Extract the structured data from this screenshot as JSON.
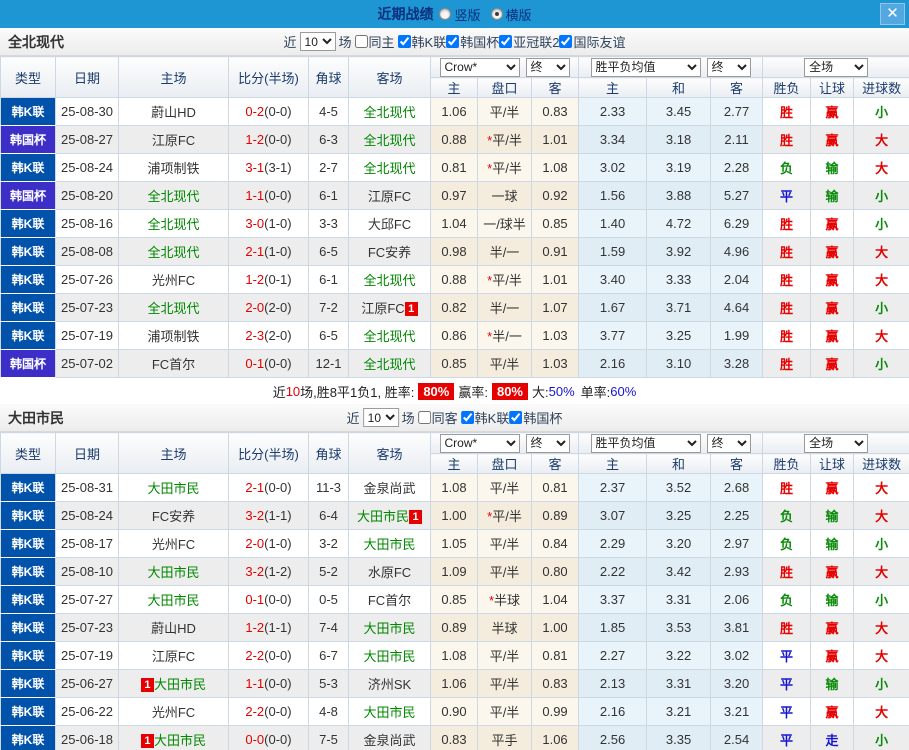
{
  "titlebar": {
    "title": "近期战绩",
    "radios": [
      {
        "label": "竖版",
        "checked": false
      },
      {
        "label": "横版",
        "checked": true
      }
    ],
    "close": "✕"
  },
  "table_header": {
    "cols": [
      "类型",
      "日期",
      "主场",
      "比分(半场)",
      "角球",
      "客场"
    ],
    "dd_odds": "Crow*",
    "dd_final": "终",
    "dd_mean": "胜平负均值",
    "dd_scope": "全场",
    "sub": [
      "主",
      "盘口",
      "客",
      "主",
      "和",
      "客",
      "胜负",
      "让球",
      "进球数"
    ]
  },
  "colors": {
    "titlebar_bg": "#1e96d4",
    "league_k": "#0052aa",
    "league_cup": "#3c2ec6",
    "team_highlight": "#008800",
    "result_red": "#e60000",
    "result_green": "#0a8a0a",
    "result_blue": "#1515d0"
  },
  "league_colors": {
    "韩K联": "k",
    "韩国杯": "cup"
  },
  "result_colors": {
    "胜": "red",
    "赢": "red",
    "大": "red",
    "平": "blue",
    "走": "blue",
    "负": "green",
    "输": "green",
    "小": "green"
  },
  "sections": [
    {
      "team": "全北现代",
      "filter": {
        "near": "近",
        "count": "10",
        "games": "场",
        "same": "同主",
        "same_checked": false,
        "leagues": [
          {
            "label": "韩K联",
            "checked": true
          },
          {
            "label": "韩国杯",
            "checked": true
          },
          {
            "label": "亚冠联2",
            "checked": true
          },
          {
            "label": "国际友谊",
            "checked": true
          }
        ]
      },
      "rows": [
        {
          "lg": "韩K联",
          "date": "25-08-30",
          "home": {
            "n": "蔚山HD",
            "g": false
          },
          "sc": "0-2",
          "hf": "(0-0)",
          "cr": "4-5",
          "away": {
            "n": "全北现代",
            "g": true
          },
          "o1": "1.06",
          "pan": "平/半",
          "o2": "0.83",
          "m": [
            "2.33",
            "3.45",
            "2.77"
          ],
          "r": [
            "胜",
            "赢",
            "小"
          ]
        },
        {
          "lg": "韩国杯",
          "date": "25-08-27",
          "home": {
            "n": "江原FC",
            "g": false
          },
          "sc": "1-2",
          "hf": "(0-0)",
          "cr": "6-3",
          "away": {
            "n": "全北现代",
            "g": true
          },
          "o1": "0.88",
          "pan": "*平/半",
          "o2": "1.01",
          "m": [
            "3.34",
            "3.18",
            "2.11"
          ],
          "r": [
            "胜",
            "赢",
            "大"
          ]
        },
        {
          "lg": "韩K联",
          "date": "25-08-24",
          "home": {
            "n": "浦项制铁",
            "g": false
          },
          "sc": "3-1",
          "hf": "(3-1)",
          "cr": "2-7",
          "away": {
            "n": "全北现代",
            "g": true
          },
          "o1": "0.81",
          "pan": "*平/半",
          "o2": "1.08",
          "m": [
            "3.02",
            "3.19",
            "2.28"
          ],
          "r": [
            "负",
            "输",
            "大"
          ]
        },
        {
          "lg": "韩国杯",
          "date": "25-08-20",
          "home": {
            "n": "全北现代",
            "g": true
          },
          "sc": "1-1",
          "hf": "(0-0)",
          "cr": "6-1",
          "away": {
            "n": "江原FC",
            "g": false
          },
          "o1": "0.97",
          "pan": "一球",
          "o2": "0.92",
          "m": [
            "1.56",
            "3.88",
            "5.27"
          ],
          "r": [
            "平",
            "输",
            "小"
          ]
        },
        {
          "lg": "韩K联",
          "date": "25-08-16",
          "home": {
            "n": "全北现代",
            "g": true
          },
          "sc": "3-0",
          "hf": "(1-0)",
          "cr": "3-3",
          "away": {
            "n": "大邱FC",
            "g": false
          },
          "o1": "1.04",
          "pan": "一/球半",
          "o2": "0.85",
          "m": [
            "1.40",
            "4.72",
            "6.29"
          ],
          "r": [
            "胜",
            "赢",
            "小"
          ]
        },
        {
          "lg": "韩K联",
          "date": "25-08-08",
          "home": {
            "n": "全北现代",
            "g": true
          },
          "sc": "2-1",
          "hf": "(1-0)",
          "cr": "6-5",
          "away": {
            "n": "FC安养",
            "g": false
          },
          "o1": "0.98",
          "pan": "半/一",
          "o2": "0.91",
          "m": [
            "1.59",
            "3.92",
            "4.96"
          ],
          "r": [
            "胜",
            "赢",
            "大"
          ]
        },
        {
          "lg": "韩K联",
          "date": "25-07-26",
          "home": {
            "n": "光州FC",
            "g": false
          },
          "sc": "1-2",
          "hf": "(0-1)",
          "cr": "6-1",
          "away": {
            "n": "全北现代",
            "g": true
          },
          "o1": "0.88",
          "pan": "*平/半",
          "o2": "1.01",
          "m": [
            "3.40",
            "3.33",
            "2.04"
          ],
          "r": [
            "胜",
            "赢",
            "大"
          ]
        },
        {
          "lg": "韩K联",
          "date": "25-07-23",
          "home": {
            "n": "全北现代",
            "g": true
          },
          "sc": "2-0",
          "hf": "(2-0)",
          "cr": "7-2",
          "away": {
            "n": "江原FC",
            "g": false,
            "b": "1",
            "bp": "after"
          },
          "o1": "0.82",
          "pan": "半/一",
          "o2": "1.07",
          "m": [
            "1.67",
            "3.71",
            "4.64"
          ],
          "r": [
            "胜",
            "赢",
            "小"
          ]
        },
        {
          "lg": "韩K联",
          "date": "25-07-19",
          "home": {
            "n": "浦项制铁",
            "g": false
          },
          "sc": "2-3",
          "hf": "(2-0)",
          "cr": "6-5",
          "away": {
            "n": "全北现代",
            "g": true
          },
          "o1": "0.86",
          "pan": "*半/一",
          "o2": "1.03",
          "m": [
            "3.77",
            "3.25",
            "1.99"
          ],
          "r": [
            "胜",
            "赢",
            "大"
          ]
        },
        {
          "lg": "韩国杯",
          "date": "25-07-02",
          "home": {
            "n": "FC首尔",
            "g": false
          },
          "sc": "0-1",
          "hf": "(0-0)",
          "cr": "12-1",
          "away": {
            "n": "全北现代",
            "g": true
          },
          "o1": "0.85",
          "pan": "平/半",
          "o2": "1.03",
          "m": [
            "2.16",
            "3.10",
            "3.28"
          ],
          "r": [
            "胜",
            "赢",
            "小"
          ]
        }
      ],
      "summary": {
        "pre": "近",
        "count": "10",
        "mid": "场,胜8平1负1, 胜率:",
        "win_rate": "80%",
        "mid2": "赢率:",
        "cover_rate": "80%",
        "mid3": "大:",
        "over": "50%",
        "mid4": "单率:",
        "single": "60%"
      }
    },
    {
      "team": "大田市民",
      "filter": {
        "near": "近",
        "count": "10",
        "games": "场",
        "same": "同客",
        "same_checked": false,
        "leagues": [
          {
            "label": "韩K联",
            "checked": true
          },
          {
            "label": "韩国杯",
            "checked": true
          }
        ]
      },
      "rows": [
        {
          "lg": "韩K联",
          "date": "25-08-31",
          "home": {
            "n": "大田市民",
            "g": true
          },
          "sc": "2-1",
          "hf": "(0-0)",
          "cr": "11-3",
          "away": {
            "n": "金泉尚武",
            "g": false
          },
          "o1": "1.08",
          "pan": "平/半",
          "o2": "0.81",
          "m": [
            "2.37",
            "3.52",
            "2.68"
          ],
          "r": [
            "胜",
            "赢",
            "大"
          ]
        },
        {
          "lg": "韩K联",
          "date": "25-08-24",
          "home": {
            "n": "FC安养",
            "g": false
          },
          "sc": "3-2",
          "hf": "(1-1)",
          "cr": "6-4",
          "away": {
            "n": "大田市民",
            "g": true,
            "b": "1",
            "bp": "after"
          },
          "o1": "1.00",
          "pan": "*平/半",
          "o2": "0.89",
          "m": [
            "3.07",
            "3.25",
            "2.25"
          ],
          "r": [
            "负",
            "输",
            "大"
          ]
        },
        {
          "lg": "韩K联",
          "date": "25-08-17",
          "home": {
            "n": "光州FC",
            "g": false
          },
          "sc": "2-0",
          "hf": "(1-0)",
          "cr": "3-2",
          "away": {
            "n": "大田市民",
            "g": true
          },
          "o1": "1.05",
          "pan": "平/半",
          "o2": "0.84",
          "m": [
            "2.29",
            "3.20",
            "2.97"
          ],
          "r": [
            "负",
            "输",
            "小"
          ]
        },
        {
          "lg": "韩K联",
          "date": "25-08-10",
          "home": {
            "n": "大田市民",
            "g": true
          },
          "sc": "3-2",
          "hf": "(1-2)",
          "cr": "5-2",
          "away": {
            "n": "水原FC",
            "g": false
          },
          "o1": "1.09",
          "pan": "平/半",
          "o2": "0.80",
          "m": [
            "2.22",
            "3.42",
            "2.93"
          ],
          "r": [
            "胜",
            "赢",
            "大"
          ]
        },
        {
          "lg": "韩K联",
          "date": "25-07-27",
          "home": {
            "n": "大田市民",
            "g": true
          },
          "sc": "0-1",
          "hf": "(0-0)",
          "cr": "0-5",
          "away": {
            "n": "FC首尔",
            "g": false
          },
          "o1": "0.85",
          "pan": "*半球",
          "o2": "1.04",
          "m": [
            "3.37",
            "3.31",
            "2.06"
          ],
          "r": [
            "负",
            "输",
            "小"
          ]
        },
        {
          "lg": "韩K联",
          "date": "25-07-23",
          "home": {
            "n": "蔚山HD",
            "g": false
          },
          "sc": "1-2",
          "hf": "(1-1)",
          "cr": "7-4",
          "away": {
            "n": "大田市民",
            "g": true
          },
          "o1": "0.89",
          "pan": "半球",
          "o2": "1.00",
          "m": [
            "1.85",
            "3.53",
            "3.81"
          ],
          "r": [
            "胜",
            "赢",
            "大"
          ]
        },
        {
          "lg": "韩K联",
          "date": "25-07-19",
          "home": {
            "n": "江原FC",
            "g": false
          },
          "sc": "2-2",
          "hf": "(0-0)",
          "cr": "6-7",
          "away": {
            "n": "大田市民",
            "g": true
          },
          "o1": "1.08",
          "pan": "平/半",
          "o2": "0.81",
          "m": [
            "2.27",
            "3.22",
            "3.02"
          ],
          "r": [
            "平",
            "赢",
            "大"
          ]
        },
        {
          "lg": "韩K联",
          "date": "25-06-27",
          "home": {
            "n": "大田市民",
            "g": true,
            "b": "1",
            "bp": "before"
          },
          "sc": "1-1",
          "hf": "(0-0)",
          "cr": "5-3",
          "away": {
            "n": "济州SK",
            "g": false
          },
          "o1": "1.06",
          "pan": "平/半",
          "o2": "0.83",
          "m": [
            "2.13",
            "3.31",
            "3.20"
          ],
          "r": [
            "平",
            "输",
            "小"
          ]
        },
        {
          "lg": "韩K联",
          "date": "25-06-22",
          "home": {
            "n": "光州FC",
            "g": false
          },
          "sc": "2-2",
          "hf": "(0-0)",
          "cr": "4-8",
          "away": {
            "n": "大田市民",
            "g": true
          },
          "o1": "0.90",
          "pan": "平/半",
          "o2": "0.99",
          "m": [
            "2.16",
            "3.21",
            "3.21"
          ],
          "r": [
            "平",
            "赢",
            "大"
          ]
        },
        {
          "lg": "韩K联",
          "date": "25-06-18",
          "home": {
            "n": "大田市民",
            "g": true,
            "b": "1",
            "bp": "before"
          },
          "sc": "0-0",
          "hf": "(0-0)",
          "cr": "7-5",
          "away": {
            "n": "金泉尚武",
            "g": false
          },
          "o1": "0.83",
          "pan": "平手",
          "o2": "1.06",
          "m": [
            "2.56",
            "3.35",
            "2.54"
          ],
          "r": [
            "平",
            "走",
            "小"
          ]
        }
      ]
    }
  ]
}
